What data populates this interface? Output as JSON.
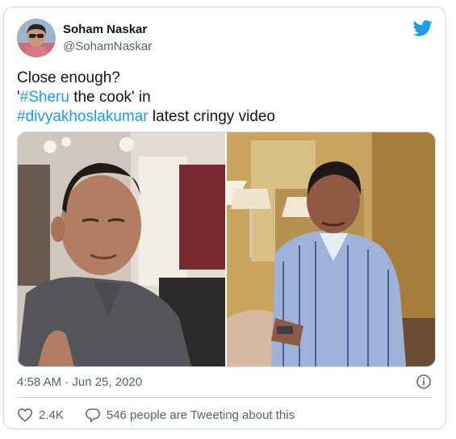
{
  "user": {
    "name": "Soham Naskar",
    "handle": "@SohamNaskar"
  },
  "tweet": {
    "line1": "Close enough?",
    "line2_prefix": "'",
    "line2_link": "#Sheru",
    "line2_suffix": " the cook' in",
    "line3_link": "#divyakhoslakumar",
    "line3_suffix": " latest cringy video",
    "timestamp": "4:58 AM · Jun 25, 2020"
  },
  "engagement": {
    "likes": "2.4K",
    "tweeting": "546 people are Tweeting about this"
  },
  "colors": {
    "link": "#1d9bf0",
    "twitter_blue": "#1d9bf0",
    "secondary_text": "#536471",
    "border": "#cfd9de"
  },
  "icons": {
    "platform": "twitter-bird-icon",
    "info": "info-icon",
    "like": "heart-icon",
    "reply": "speech-bubble-icon"
  }
}
